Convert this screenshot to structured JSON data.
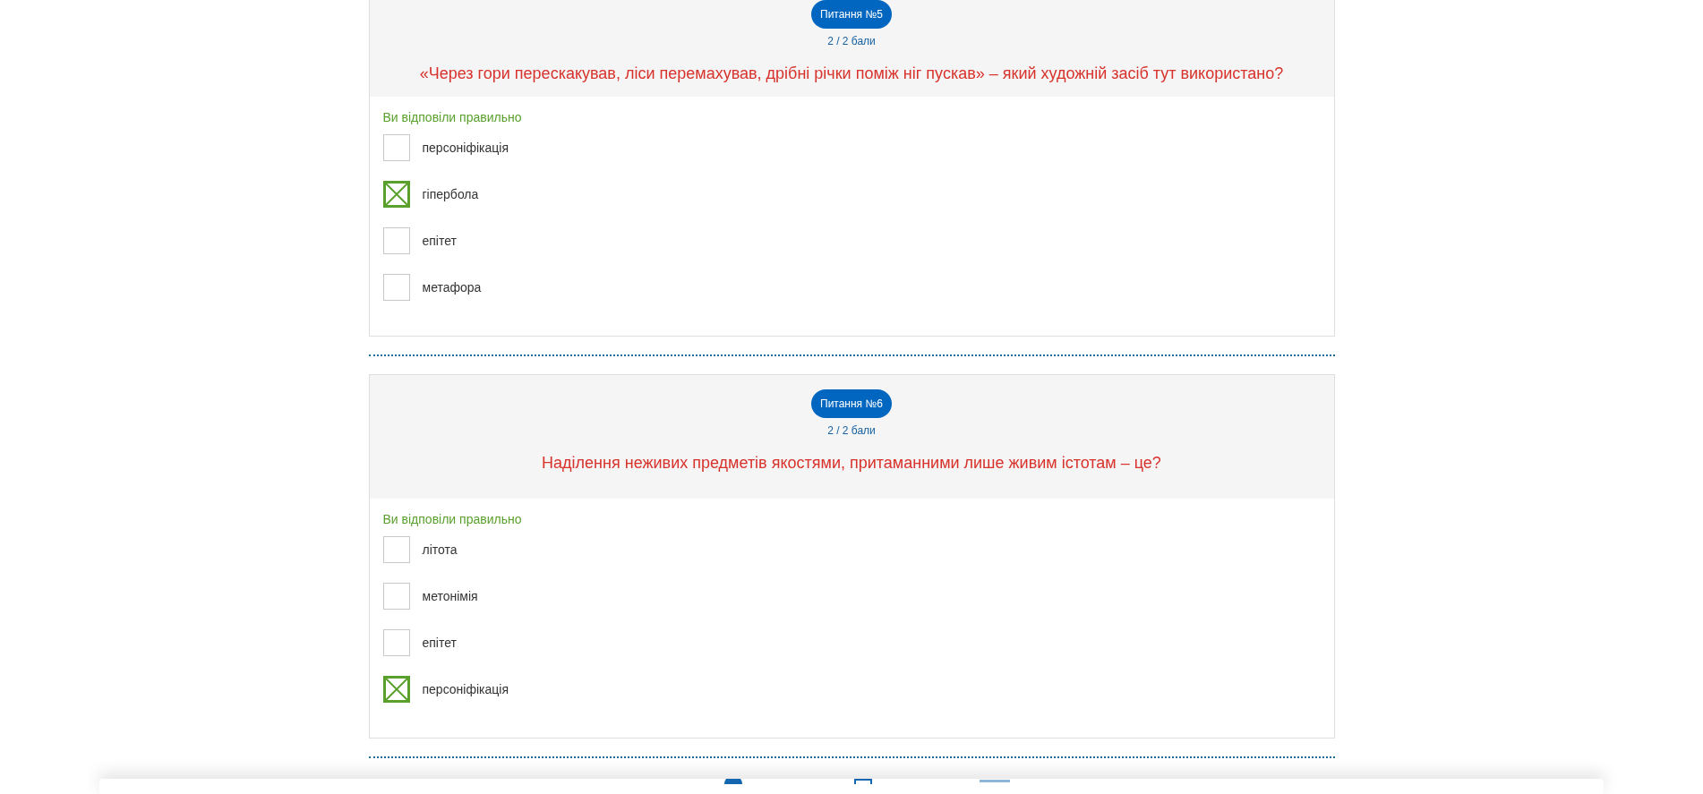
{
  "questions": [
    {
      "badge": "Питання №5",
      "score": "2 / 2 бали",
      "question": "«Через гори перескакував, ліси перемахував, дрібні річки поміж ніг пускав» – який художній засіб тут використано?",
      "result": "Ви відповіли правильно",
      "options": [
        {
          "label": "персоніфікація",
          "checked": false
        },
        {
          "label": "гіпербола",
          "checked": true
        },
        {
          "label": "епітет",
          "checked": false
        },
        {
          "label": "метафора",
          "checked": false
        }
      ]
    },
    {
      "badge": "Питання №6",
      "score": "2 / 2 бали",
      "question": "Наділення неживих предметів якостями, притаманними лише живим істотам – це?",
      "result": "Ви відповіли правильно",
      "options": [
        {
          "label": "літота",
          "checked": false
        },
        {
          "label": "метонімія",
          "checked": false
        },
        {
          "label": "епітет",
          "checked": false
        },
        {
          "label": "персоніфікація",
          "checked": true
        }
      ]
    }
  ]
}
